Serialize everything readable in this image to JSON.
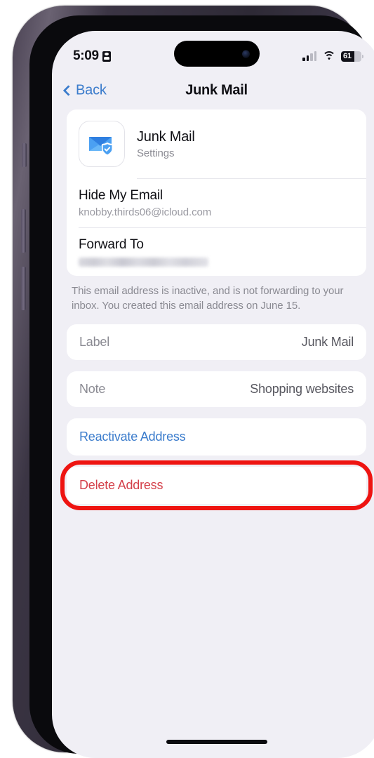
{
  "status_bar": {
    "time": "5:09",
    "recording_icon": "id-card-icon",
    "cellular_icon": "cellular-bars-icon",
    "wifi_icon": "wifi-icon",
    "battery_level": "61",
    "battery_icon": "battery-icon"
  },
  "nav": {
    "back_label": "Back",
    "back_icon": "chevron-left-icon",
    "title": "Junk Mail"
  },
  "header_card": {
    "app_icon": "hide-my-email-envelope-shield-icon",
    "title": "Junk Mail",
    "subtitle": "Settings",
    "rows": [
      {
        "label": "Hide My Email",
        "value": "knobby.thirds06@icloud.com",
        "redacted": false
      },
      {
        "label": "Forward To",
        "value": "",
        "redacted": true
      }
    ]
  },
  "footnote": "This email address is inactive, and is not forwarding to your inbox. You created this email address on June 15.",
  "detail_rows": [
    {
      "key": "Label",
      "value": "Junk Mail"
    },
    {
      "key": "Note",
      "value": "Shopping websites"
    }
  ],
  "actions": {
    "reactivate_label": "Reactivate Address",
    "delete_label": "Delete Address"
  },
  "colors": {
    "accent_blue": "#3b7ccc",
    "destructive_red": "#d4404a",
    "annotation_red": "#ee1411",
    "screen_background": "#f0eff5",
    "card_background": "#ffffff"
  }
}
